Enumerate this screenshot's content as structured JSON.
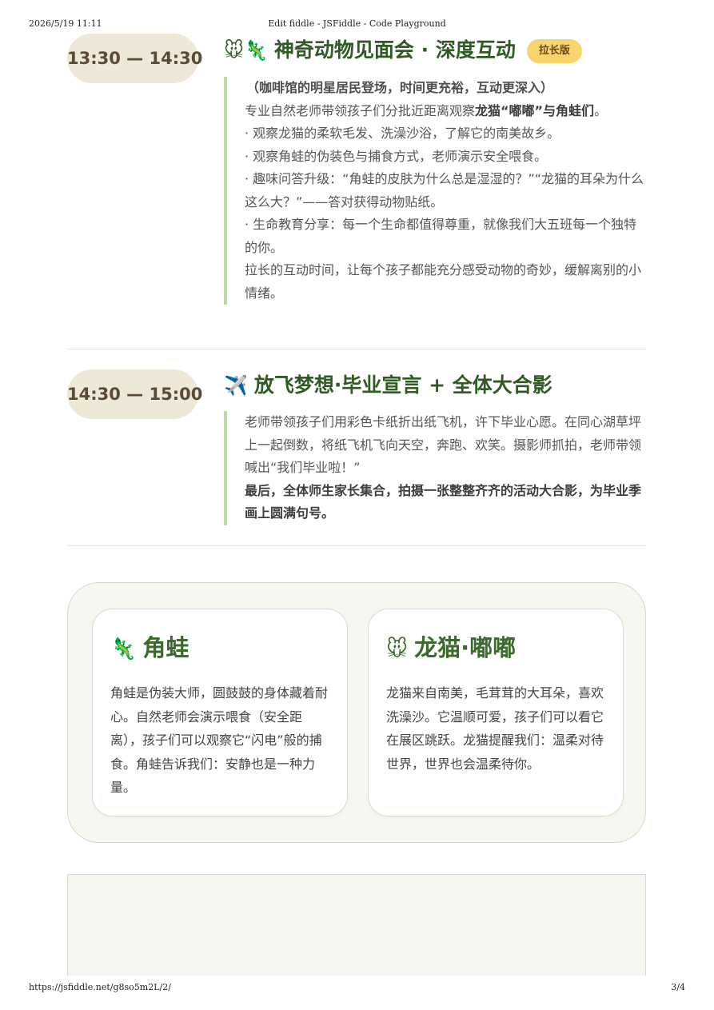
{
  "print_header": {
    "datetime": "2026/5/19 11:11",
    "title": "Edit fiddle - JSFiddle - Code Playground"
  },
  "print_footer": {
    "url": "https://jsfiddle.net/g8so5m2L/2/",
    "page": "3/4"
  },
  "slots": [
    {
      "time": "13:30 — 14:30",
      "emoji": "🐭🦎",
      "title": "神奇动物见面会 · 深度互动",
      "badge": "拉长版",
      "subtitle": "（咖啡馆的明星居民登场，时间更充裕，互动更深入）",
      "intro_prefix": "专业自然老师带领孩子们分批近距离观察",
      "intro_strong": "龙猫“嘟嘟”与角蛙们",
      "intro_suffix": "。",
      "bullets": [
        "· 观察龙猫的柔软毛发、洗澡沙浴，了解它的南美故乡。",
        "· 观察角蛙的伪装色与捕食方式，老师演示安全喂食。",
        "· 趣味问答升级：“角蛙的皮肤为什么总是湿湿的？”“龙猫的耳朵为什么这么大？”——答对获得动物贴纸。",
        "· 生命教育分享：每一个生命都值得尊重，就像我们大五班每一个独特的你。"
      ],
      "closing": "拉长的互动时间，让每个孩子都能充分感受动物的奇妙，缓解离别的小情绪。"
    },
    {
      "time": "14:30 — 15:00",
      "emoji": "✈️",
      "title": "放飞梦想·毕业宣言 + 全体大合影",
      "body": "老师带领孩子们用彩色卡纸折出纸飞机，许下毕业心愿。在同心湖草坪上一起倒数，将纸飞机飞向天空，奔跑、欢笑。摄影师抓拍，老师带领喊出“我们毕业啦！”",
      "strong": "最后，全体师生家长集合，拍摄一张整整齐齐的活动大合影，为毕业季画上圆满句号。"
    }
  ],
  "animal_cards": [
    {
      "emoji": "🦎",
      "name": "角蛙",
      "text": "角蛙是伪装大师，圆鼓鼓的身体藏着耐心。自然老师会演示喂食（安全距离），孩子们可以观察它“闪电”般的捕食。角蛙告诉我们：安静也是一种力量。"
    },
    {
      "emoji": "🐭",
      "name": "龙猫·嘟嘟",
      "text": "龙猫来自南美，毛茸茸的大耳朵，喜欢洗澡沙。它温顺可爱，孩子们可以看它在展区跳跃。龙猫提醒我们：温柔对待世界，世界也会温柔待你。"
    }
  ],
  "colors": {
    "time_pill_bg": "#ede8d8",
    "title_green": "#2f5a24",
    "badge_yellow": "#f7d46d",
    "desc_border": "#bcdaa4",
    "panel_bg": "#f7f7f2"
  }
}
